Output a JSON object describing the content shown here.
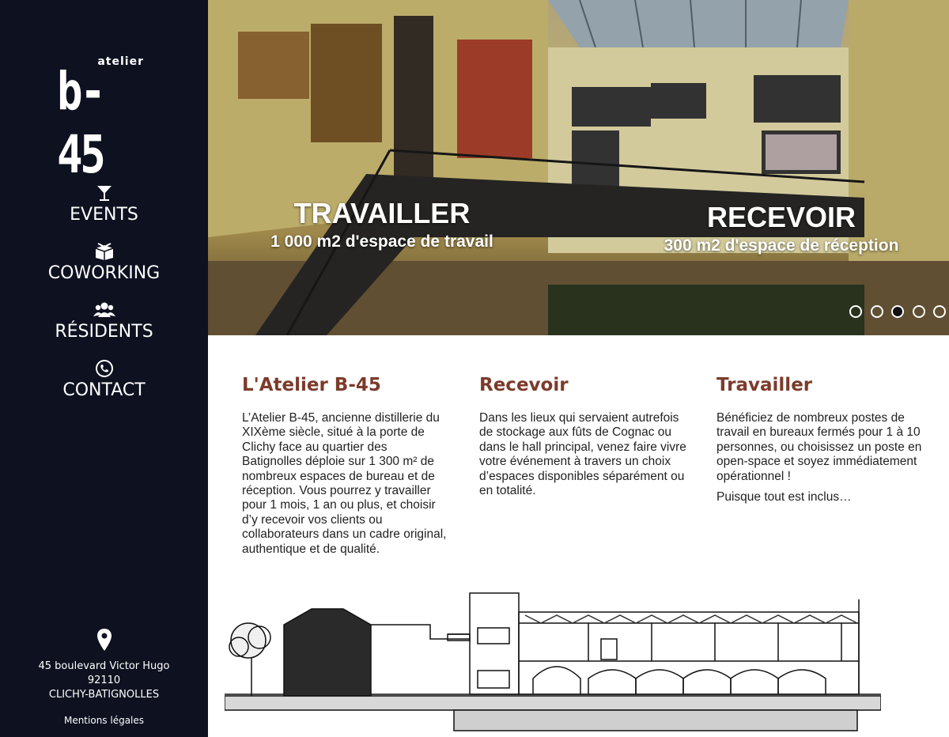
{
  "brand": {
    "small": "atelier",
    "big": "b-45"
  },
  "nav": {
    "items": [
      {
        "label": "EVENTS",
        "icon": "cocktail-icon"
      },
      {
        "label": "COWORKING",
        "icon": "box-icon"
      },
      {
        "label": "RÉSIDENTS",
        "icon": "users-icon"
      },
      {
        "label": "CONTACT",
        "icon": "phone-icon"
      }
    ]
  },
  "address": {
    "icon": "map-pin-icon",
    "street": "45 boulevard Victor Hugo",
    "zip": "92110",
    "city": "CLICHY-BATIGNOLLES"
  },
  "legal": "Mentions légales",
  "hero": {
    "captions": [
      {
        "title": "TRAVAILLER",
        "subtitle": "1 000 m2 d'espace de travail"
      },
      {
        "title": "RECEVOIR",
        "subtitle": "300 m2 d'espace de réception"
      }
    ],
    "slides_count": 5,
    "active_slide": 3
  },
  "columns": [
    {
      "title": "L'Atelier B-45",
      "paragraphs": [
        "L’Atelier B-45, ancienne distillerie du XIXème siècle, situé à la porte de Clichy face au quartier des Batignolles déploie sur 1 300 m² de nombreux espaces de bureau et de réception. Vous pourrez y travailler pour 1 mois, 1 an ou plus, et choisir d’y recevoir vos clients ou collaborateurs dans un cadre original, authentique et de qualité."
      ]
    },
    {
      "title": "Recevoir",
      "paragraphs": [
        "Dans les lieux qui servaient autrefois de stockage aux fûts de Cognac ou dans le hall principal, venez faire vivre votre événement à travers un choix d’espaces disponibles séparément ou en totalité."
      ]
    },
    {
      "title": "Travailler",
      "paragraphs": [
        "Bénéficiez de nombreux postes de travail en bureaux fermés pour 1 à 10 personnes, ou choisissez un poste en open-space et soyez immédiatement opérationnel !",
        "Puisque tout est inclus…"
      ]
    }
  ],
  "colors": {
    "sidebar": "#0e1120",
    "heading": "#7c3b2b",
    "text": "#222222"
  }
}
